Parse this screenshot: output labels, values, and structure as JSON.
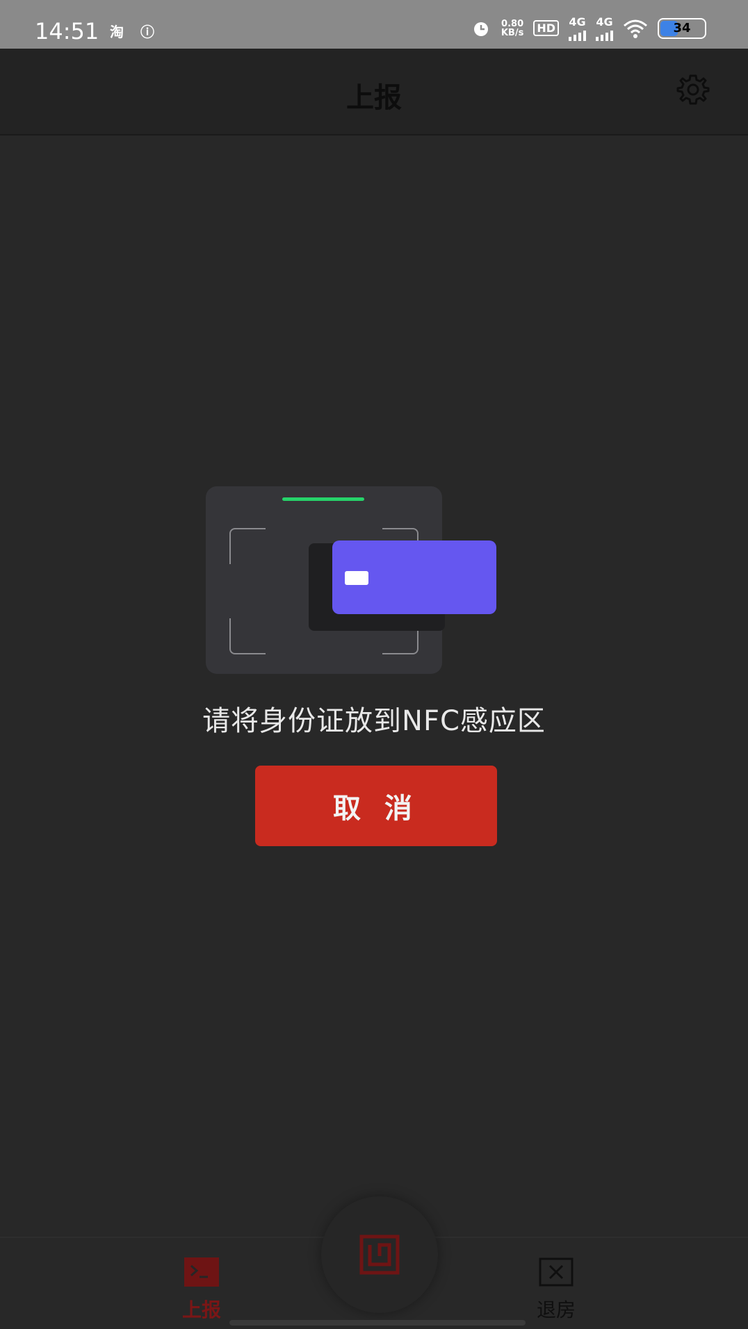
{
  "status_bar": {
    "time": "14:51",
    "app_icons": [
      "淘",
      "ⓘ"
    ],
    "net_speed_value": "0.80",
    "net_speed_unit": "KB/s",
    "hd_label": "HD",
    "sim_slots": "1\n2",
    "signal1": "4G",
    "signal2": "4G",
    "battery": "34",
    "battery_color": "#3d82e6"
  },
  "header": {
    "title": "上报"
  },
  "main": {
    "nfc_prompt": "请将身份证放到NFC感应区",
    "cancel_label": "取 消",
    "colors": {
      "card": "#6557f0",
      "led": "#26d36a",
      "cancel": "#c92b1f"
    }
  },
  "bottom_nav": {
    "items": [
      {
        "label": "上报",
        "icon": "terminal-icon",
        "active": true
      },
      {
        "label": "退房",
        "icon": "close-box-icon",
        "active": false
      }
    ],
    "center_icon": "nfc-scan-icon"
  }
}
